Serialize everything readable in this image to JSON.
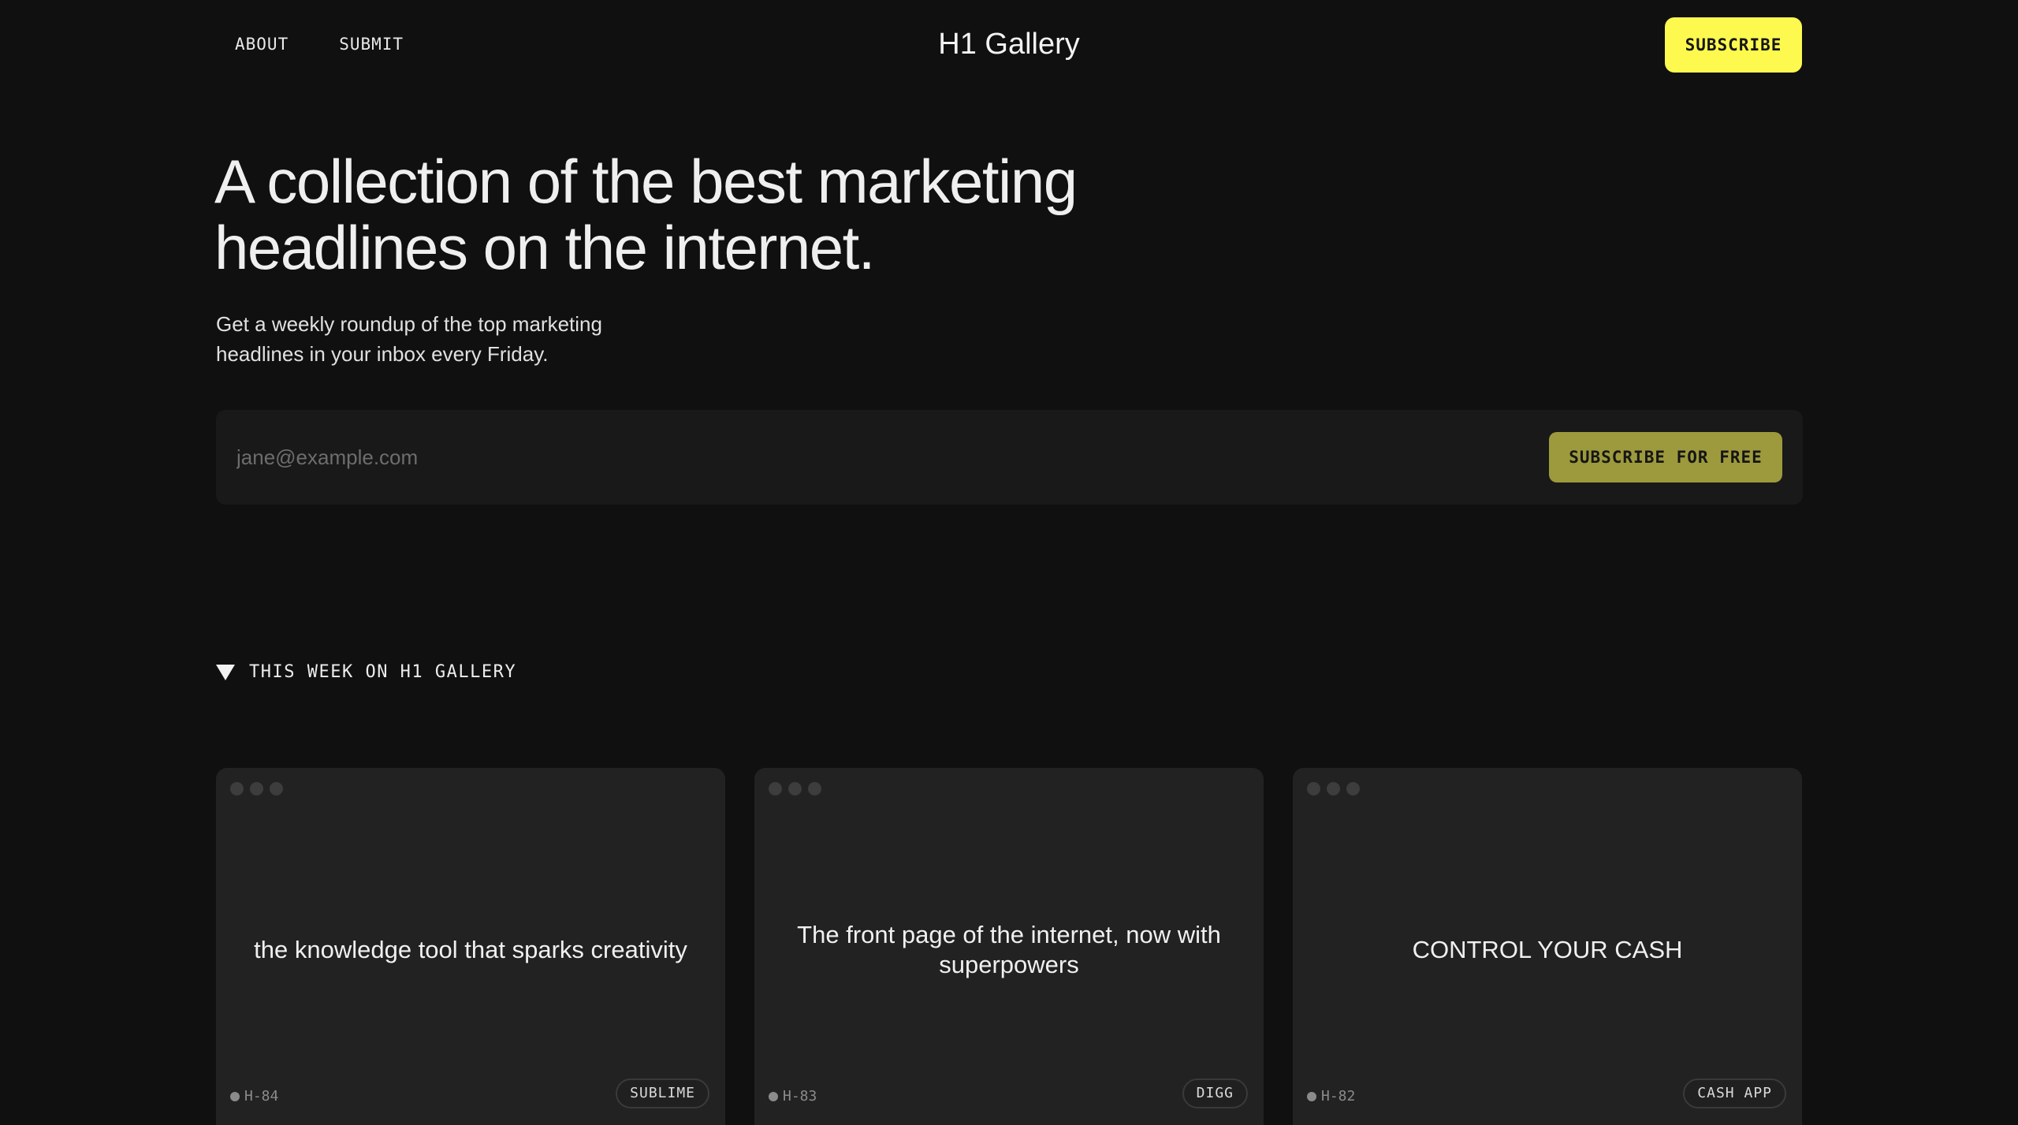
{
  "header": {
    "nav": [
      {
        "label": "ABOUT"
      },
      {
        "label": "SUBMIT"
      }
    ],
    "brand": "H1 Gallery",
    "subscribe_label": "SUBSCRIBE",
    "accent_color": "#fdf94f"
  },
  "hero": {
    "title": "A collection of the best marketing headlines on the internet.",
    "subtitle": "Get a weekly roundup of the top marketing headlines in your inbox every Friday."
  },
  "signup": {
    "email_placeholder": "jane@example.com",
    "email_value": "",
    "button_label": "SUBSCRIBE FOR FREE",
    "button_color": "#9c9a3c"
  },
  "section": {
    "icon": "triangle-down-icon",
    "label": "THIS WEEK ON H1 GALLERY"
  },
  "cards": [
    {
      "headline": "the knowledge tool that sparks creativity",
      "id": "H-84",
      "tag": "SUBLIME"
    },
    {
      "headline": "The front page of the internet, now with superpowers",
      "id": "H-83",
      "tag": "DIGG"
    },
    {
      "headline": "CONTROL YOUR CASH",
      "id": "H-82",
      "tag": "CASH APP"
    }
  ]
}
